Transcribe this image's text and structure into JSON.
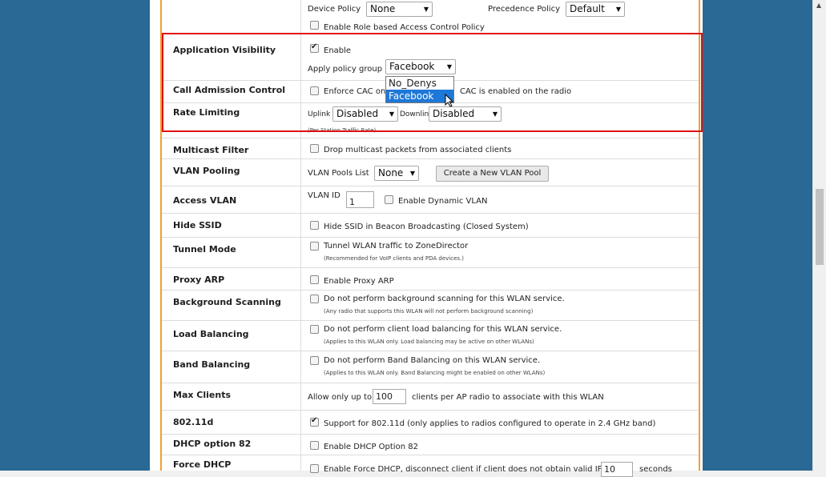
{
  "top": {
    "device_policy_label": "Device Policy",
    "device_policy_value": "None",
    "precedence_policy_label": "Precedence Policy",
    "precedence_policy_value": "Default",
    "role_based_label": "Enable Role based Access Control Policy"
  },
  "app_visibility": {
    "label": "Application Visibility",
    "enable_label": "Enable",
    "policy_group_label": "Apply policy group",
    "policy_group_value": "Facebook",
    "options": [
      "No_Denys",
      "Facebook"
    ]
  },
  "call_admission": {
    "label": "Call Admission Control",
    "text_left": "Enforce CAC on",
    "text_right": "CAC is enabled on the radio"
  },
  "rate_limiting": {
    "label": "Rate Limiting",
    "uplink_label": "Uplink",
    "uplink_value": "Disabled",
    "downlink_label": "Downlink",
    "downlink_value": "Disabled",
    "note": "(Per Station Traffic Rate)"
  },
  "multicast": {
    "label": "Multicast Filter",
    "text": "Drop multicast packets from associated clients"
  },
  "vlan_pooling": {
    "label": "VLAN Pooling",
    "list_label": "VLAN Pools List",
    "list_value": "None",
    "create_button": "Create a New VLAN Pool"
  },
  "access_vlan": {
    "label": "Access VLAN",
    "id_label": "VLAN ID",
    "id_value": "1",
    "dynamic_label": "Enable Dynamic VLAN"
  },
  "hide_ssid": {
    "label": "Hide SSID",
    "text": "Hide SSID in Beacon Broadcasting (Closed System)"
  },
  "tunnel": {
    "label": "Tunnel Mode",
    "text": "Tunnel WLAN traffic to ZoneDirector",
    "note": "(Recommended for VoIP clients and PDA devices.)"
  },
  "proxy_arp": {
    "label": "Proxy ARP",
    "text": "Enable Proxy ARP"
  },
  "bg_scan": {
    "label": "Background Scanning",
    "text": "Do not perform background scanning for this WLAN service.",
    "note": "(Any radio that supports this WLAN will not perform background scanning)"
  },
  "load_bal": {
    "label": "Load Balancing",
    "text": "Do not perform client load balancing for this WLAN service.",
    "note": "(Applies to this WLAN only. Load balancing may be active on other WLANs)"
  },
  "band_bal": {
    "label": "Band Balancing",
    "text": "Do not perform Band Balancing on this WLAN service.",
    "note": "(Applies to this WLAN only. Band Balancing might be enabled on other WLANs)"
  },
  "max_clients": {
    "label": "Max Clients",
    "text_left": "Allow only up to",
    "value": "100",
    "text_right": "clients per AP radio to associate with this WLAN"
  },
  "dot11d": {
    "label": "802.11d",
    "text": "Support for 802.11d (only applies to radios configured to operate in 2.4 GHz band)"
  },
  "dhcp82": {
    "label": "DHCP option 82",
    "text": "Enable DHCP Option 82"
  },
  "force_dhcp": {
    "label": "Force DHCP",
    "text": "Enable Force DHCP, disconnect client if client does not obtain valid IP in",
    "value": "10",
    "unit": "seconds"
  },
  "colors": {
    "sidebar": "#2a6896",
    "accent": "#f0a030",
    "highlight": "#e01010",
    "selected": "#1e78d7"
  }
}
